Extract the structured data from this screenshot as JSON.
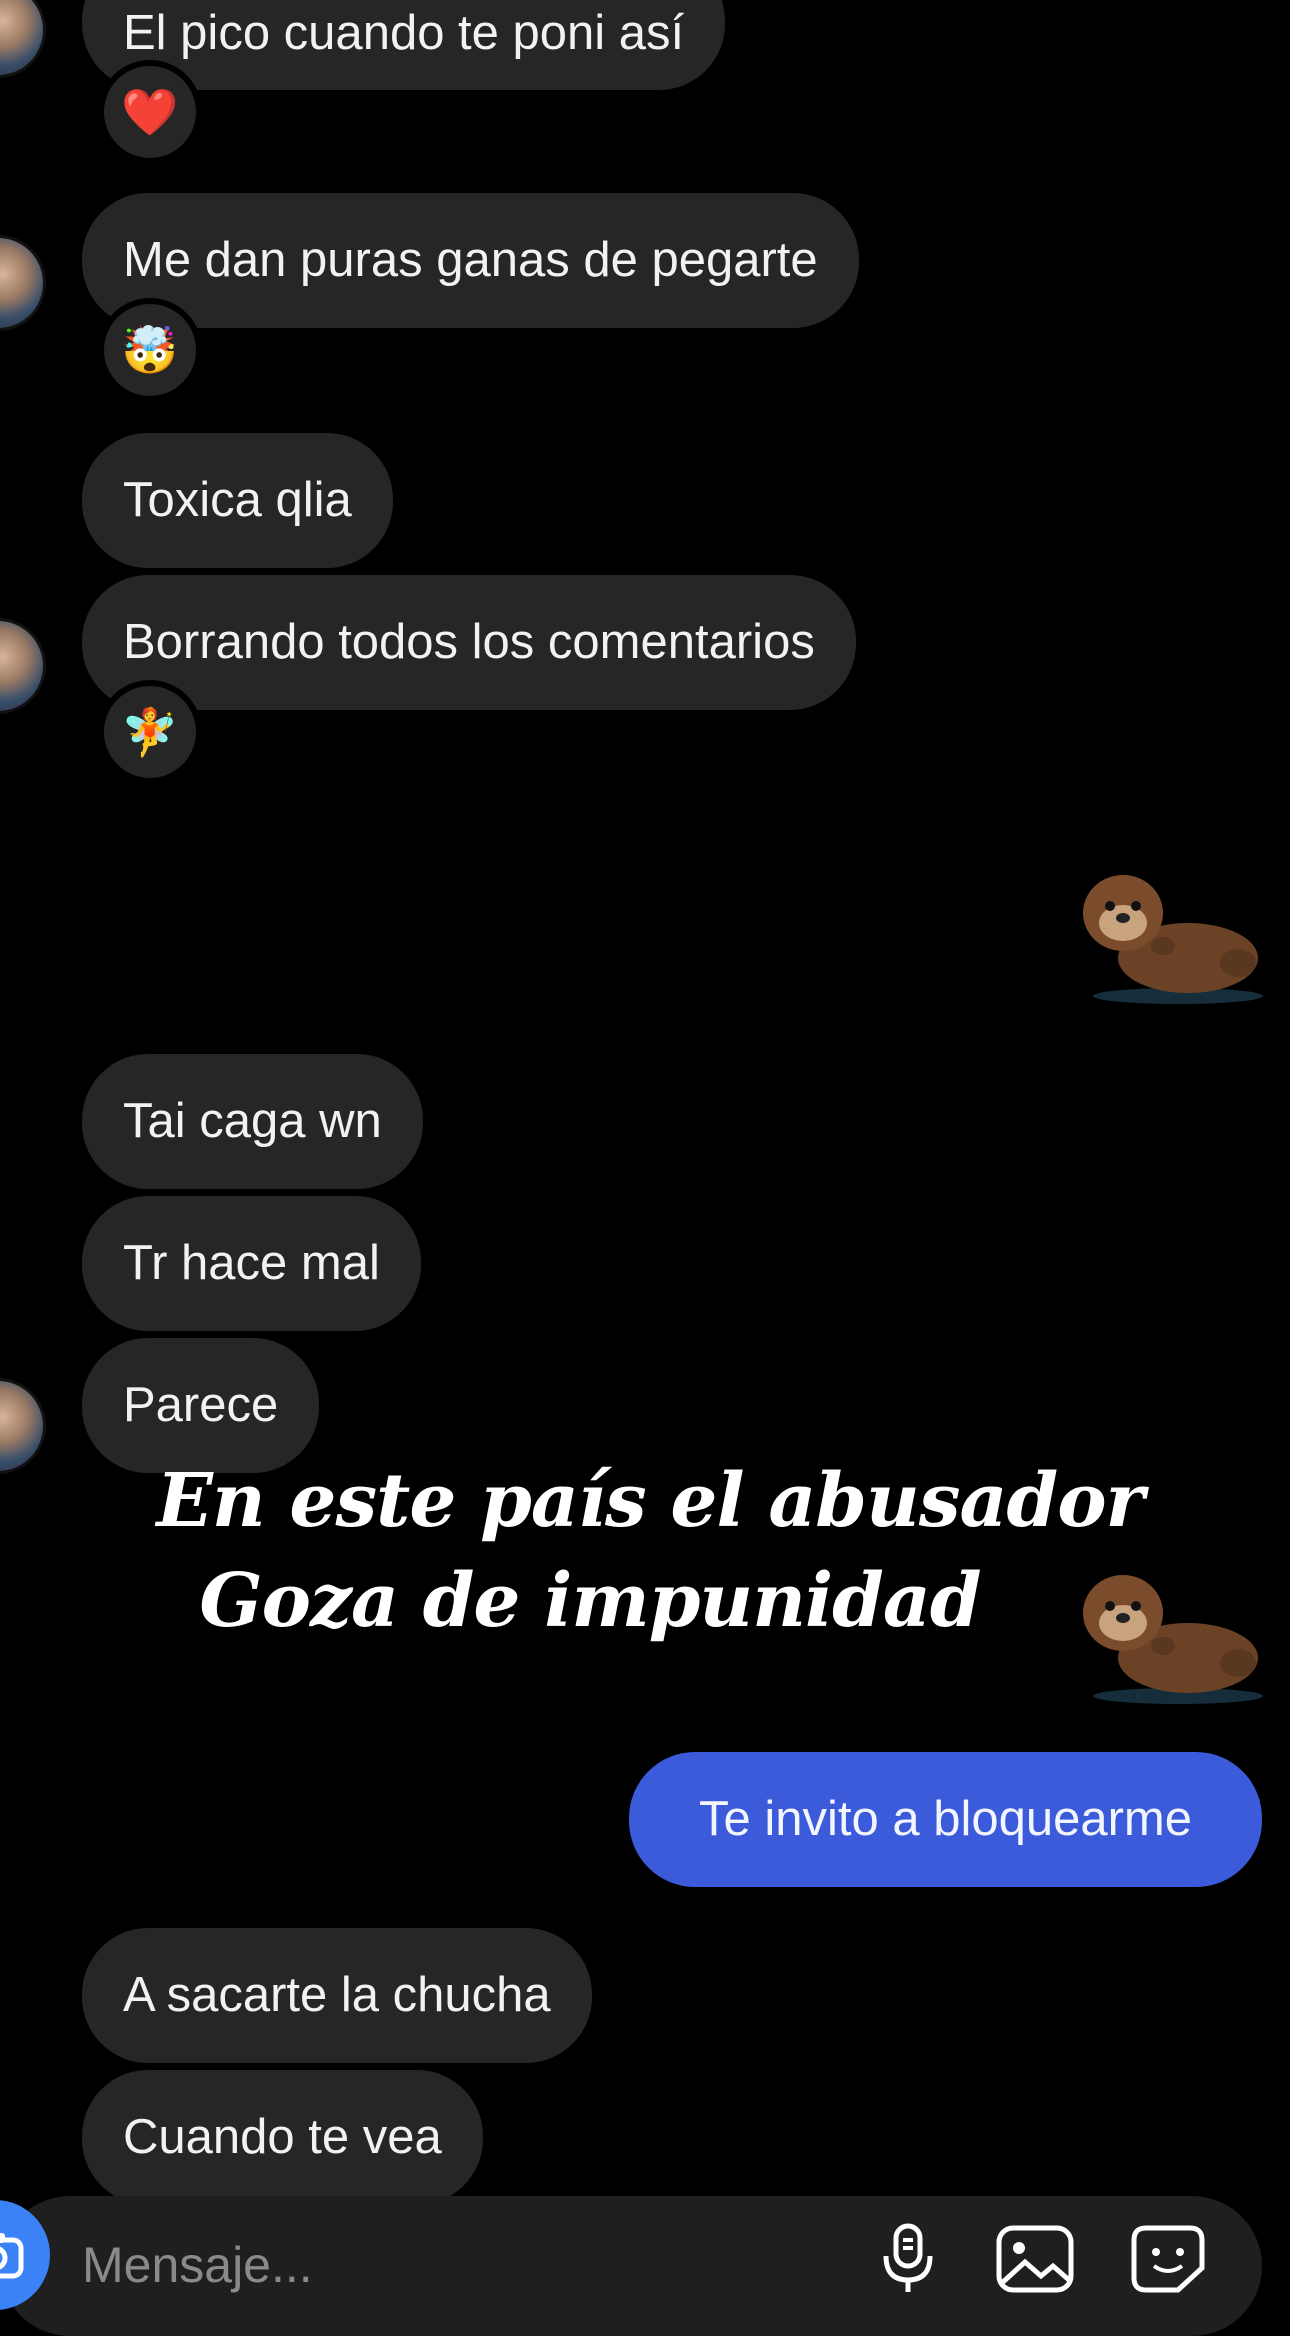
{
  "messages": [
    {
      "text": "El pico cuando te poni así",
      "side": "received"
    },
    {
      "text": "Me dan puras ganas de pegarte",
      "side": "received"
    },
    {
      "text": "Toxica qlia",
      "side": "received"
    },
    {
      "text": "Borrando todos los comentarios",
      "side": "received"
    },
    {
      "text": "Tai caga wn",
      "side": "received"
    },
    {
      "text": "Tr hace mal",
      "side": "received"
    },
    {
      "text": "Parece",
      "side": "received"
    },
    {
      "text": "Te invito a bloquearme",
      "side": "sent"
    },
    {
      "text": "A sacarte la chucha",
      "side": "received"
    },
    {
      "text": "Cuando te vea",
      "side": "received"
    }
  ],
  "reactions": [
    "❤️",
    "🤯",
    "🧚"
  ],
  "caption": {
    "line1": "En este país el abusador",
    "line2": "Goza de impunidad"
  },
  "composer": {
    "placeholder": "Mensaje..."
  },
  "icons": {
    "camera": "camera-icon",
    "mic": "microphone-icon",
    "gallery": "image-icon",
    "sticker": "sticker-icon",
    "otter": "otter-sticker"
  },
  "colors": {
    "background": "#000000",
    "received_bubble": "#262626",
    "sent_bubble": "#3b5bdb",
    "accent": "#3b82f6"
  }
}
